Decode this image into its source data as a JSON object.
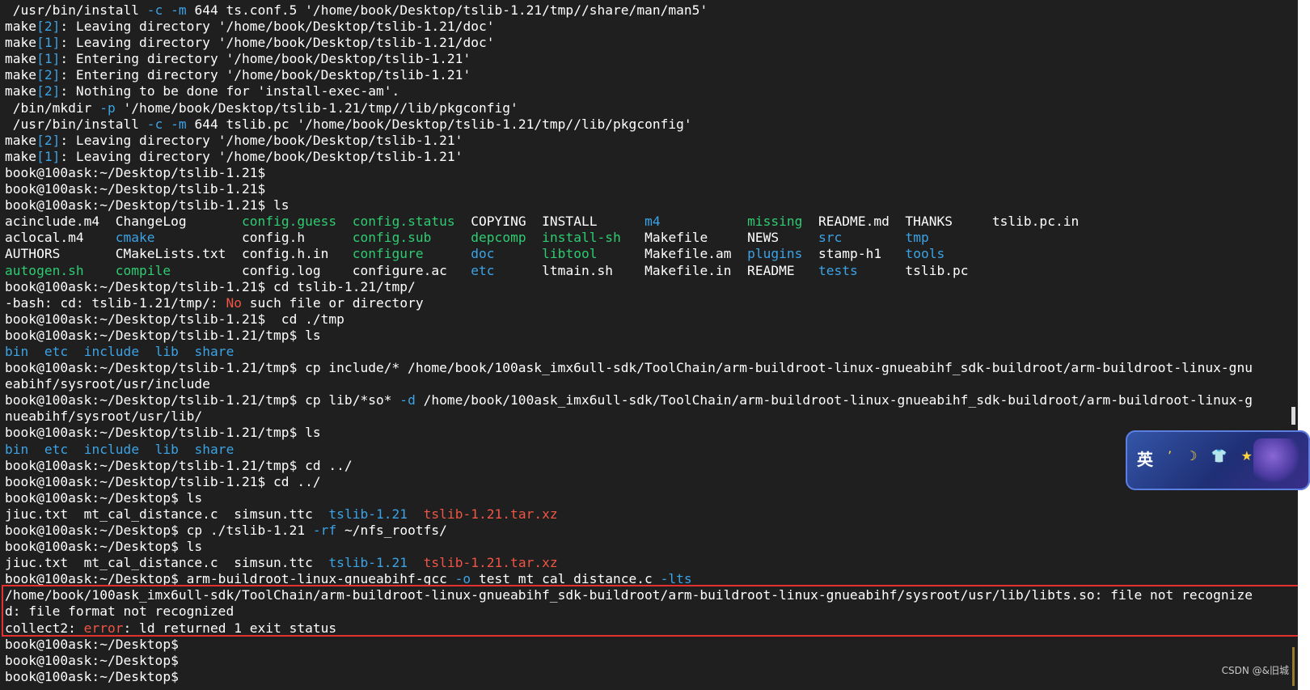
{
  "terminal": {
    "lines": [
      [
        {
          "t": " /usr/bin/install ",
          "c": "w"
        },
        {
          "t": "-c",
          "c": "c"
        },
        {
          "t": " ",
          "c": "w"
        },
        {
          "t": "-m",
          "c": "c"
        },
        {
          "t": " 644 ts.conf.5 '/home/book/Desktop/tslib-1.21/tmp//share/man/man5'",
          "c": "w"
        }
      ],
      [
        {
          "t": "make",
          "c": "w"
        },
        {
          "t": "[2]",
          "c": "c"
        },
        {
          "t": ": Leaving directory '/home/book/Desktop/tslib-1.21/doc'",
          "c": "w"
        }
      ],
      [
        {
          "t": "make",
          "c": "w"
        },
        {
          "t": "[1]",
          "c": "c"
        },
        {
          "t": ": Leaving directory '/home/book/Desktop/tslib-1.21/doc'",
          "c": "w"
        }
      ],
      [
        {
          "t": "make",
          "c": "w"
        },
        {
          "t": "[1]",
          "c": "c"
        },
        {
          "t": ": Entering directory '/home/book/Desktop/tslib-1.21'",
          "c": "w"
        }
      ],
      [
        {
          "t": "make",
          "c": "w"
        },
        {
          "t": "[2]",
          "c": "c"
        },
        {
          "t": ": Entering directory '/home/book/Desktop/tslib-1.21'",
          "c": "w"
        }
      ],
      [
        {
          "t": "make",
          "c": "w"
        },
        {
          "t": "[2]",
          "c": "c"
        },
        {
          "t": ": Nothing to be done for 'install-exec-am'.",
          "c": "w"
        }
      ],
      [
        {
          "t": " /bin/mkdir ",
          "c": "w"
        },
        {
          "t": "-p",
          "c": "c"
        },
        {
          "t": " '/home/book/Desktop/tslib-1.21/tmp//lib/pkgconfig'",
          "c": "w"
        }
      ],
      [
        {
          "t": " /usr/bin/install ",
          "c": "w"
        },
        {
          "t": "-c",
          "c": "c"
        },
        {
          "t": " ",
          "c": "w"
        },
        {
          "t": "-m",
          "c": "c"
        },
        {
          "t": " 644 tslib.pc '/home/book/Desktop/tslib-1.21/tmp//lib/pkgconfig'",
          "c": "w"
        }
      ],
      [
        {
          "t": "make",
          "c": "w"
        },
        {
          "t": "[2]",
          "c": "c"
        },
        {
          "t": ": Leaving directory '/home/book/Desktop/tslib-1.21'",
          "c": "w"
        }
      ],
      [
        {
          "t": "make",
          "c": "w"
        },
        {
          "t": "[1]",
          "c": "c"
        },
        {
          "t": ": Leaving directory '/home/book/Desktop/tslib-1.21'",
          "c": "w"
        }
      ],
      [
        {
          "t": "book@100ask:~/Desktop/tslib-1.21$",
          "c": "w"
        }
      ],
      [
        {
          "t": "book@100ask:~/Desktop/tslib-1.21$",
          "c": "w"
        }
      ],
      [
        {
          "t": "book@100ask:~/Desktop/tslib-1.21$ ls",
          "c": "w"
        }
      ],
      [
        {
          "t": "acinclude.m4  ChangeLog       ",
          "c": "w"
        },
        {
          "t": "config.guess",
          "c": "g"
        },
        {
          "t": "  ",
          "c": "w"
        },
        {
          "t": "config.status",
          "c": "g"
        },
        {
          "t": "  COPYING  INSTALL      ",
          "c": "w"
        },
        {
          "t": "m4",
          "c": "c"
        },
        {
          "t": "           ",
          "c": "w"
        },
        {
          "t": "missing",
          "c": "g"
        },
        {
          "t": "  README.md  THANKS     tslib.pc.in",
          "c": "w"
        }
      ],
      [
        {
          "t": "aclocal.m4    ",
          "c": "w"
        },
        {
          "t": "cmake",
          "c": "c"
        },
        {
          "t": "           config.h      ",
          "c": "w"
        },
        {
          "t": "config.sub",
          "c": "g"
        },
        {
          "t": "     ",
          "c": "w"
        },
        {
          "t": "depcomp",
          "c": "g"
        },
        {
          "t": "  ",
          "c": "w"
        },
        {
          "t": "install-sh",
          "c": "g"
        },
        {
          "t": "   Makefile     NEWS     ",
          "c": "w"
        },
        {
          "t": "src",
          "c": "c"
        },
        {
          "t": "        ",
          "c": "w"
        },
        {
          "t": "tmp",
          "c": "c"
        }
      ],
      [
        {
          "t": "AUTHORS       CMakeLists.txt  config.h.in   ",
          "c": "w"
        },
        {
          "t": "configure",
          "c": "g"
        },
        {
          "t": "      ",
          "c": "w"
        },
        {
          "t": "doc",
          "c": "c"
        },
        {
          "t": "      ",
          "c": "w"
        },
        {
          "t": "libtool",
          "c": "g"
        },
        {
          "t": "      Makefile.am  ",
          "c": "w"
        },
        {
          "t": "plugins",
          "c": "c"
        },
        {
          "t": "  stamp-h1   ",
          "c": "w"
        },
        {
          "t": "tools",
          "c": "c"
        }
      ],
      [
        {
          "t": "autogen.sh",
          "c": "g"
        },
        {
          "t": "    ",
          "c": "w"
        },
        {
          "t": "compile",
          "c": "g"
        },
        {
          "t": "         config.log    configure.ac   ",
          "c": "w"
        },
        {
          "t": "etc",
          "c": "c"
        },
        {
          "t": "      ltmain.sh    Makefile.in  README   ",
          "c": "w"
        },
        {
          "t": "tests",
          "c": "c"
        },
        {
          "t": "      tslib.pc",
          "c": "w"
        }
      ],
      [
        {
          "t": "book@100ask:~/Desktop/tslib-1.21$ cd tslib-1.21/tmp/",
          "c": "w"
        }
      ],
      [
        {
          "t": "-bash: cd: tslib-1.21/tmp/: ",
          "c": "w"
        },
        {
          "t": "No",
          "c": "r"
        },
        {
          "t": " such file or directory",
          "c": "w"
        }
      ],
      [
        {
          "t": "book@100ask:~/Desktop/tslib-1.21$  cd ./tmp",
          "c": "w"
        }
      ],
      [
        {
          "t": "book@100ask:~/Desktop/tslib-1.21/tmp$ ls",
          "c": "w"
        }
      ],
      [
        {
          "t": "bin",
          "c": "c"
        },
        {
          "t": "  ",
          "c": "w"
        },
        {
          "t": "etc",
          "c": "c"
        },
        {
          "t": "  ",
          "c": "w"
        },
        {
          "t": "include",
          "c": "c"
        },
        {
          "t": "  ",
          "c": "w"
        },
        {
          "t": "lib",
          "c": "c"
        },
        {
          "t": "  ",
          "c": "w"
        },
        {
          "t": "share",
          "c": "c"
        }
      ],
      [
        {
          "t": "book@100ask:~/Desktop/tslib-1.21/tmp$ cp include/* /home/book/100ask_imx6ull-sdk/ToolChain/arm-buildroot-linux-gnueabihf_sdk-buildroot/arm-buildroot-linux-gnu",
          "c": "w"
        }
      ],
      [
        {
          "t": "eabihf/sysroot/usr/include",
          "c": "w"
        }
      ],
      [
        {
          "t": "book@100ask:~/Desktop/tslib-1.21/tmp$ cp lib/*so* ",
          "c": "w"
        },
        {
          "t": "-d",
          "c": "c"
        },
        {
          "t": " /home/book/100ask_imx6ull-sdk/ToolChain/arm-buildroot-linux-gnueabihf_sdk-buildroot/arm-buildroot-linux-g",
          "c": "w"
        }
      ],
      [
        {
          "t": "nueabihf/sysroot/usr/lib/",
          "c": "w"
        }
      ],
      [
        {
          "t": "book@100ask:~/Desktop/tslib-1.21/tmp$ ls",
          "c": "w"
        }
      ],
      [
        {
          "t": "bin",
          "c": "c"
        },
        {
          "t": "  ",
          "c": "w"
        },
        {
          "t": "etc",
          "c": "c"
        },
        {
          "t": "  ",
          "c": "w"
        },
        {
          "t": "include",
          "c": "c"
        },
        {
          "t": "  ",
          "c": "w"
        },
        {
          "t": "lib",
          "c": "c"
        },
        {
          "t": "  ",
          "c": "w"
        },
        {
          "t": "share",
          "c": "c"
        }
      ],
      [
        {
          "t": "book@100ask:~/Desktop/tslib-1.21/tmp$ cd ../",
          "c": "w"
        }
      ],
      [
        {
          "t": "book@100ask:~/Desktop/tslib-1.21$ cd ../",
          "c": "w"
        }
      ],
      [
        {
          "t": "book@100ask:~/Desktop$ ls",
          "c": "w"
        }
      ],
      [
        {
          "t": "jiuc.txt  mt_cal_distance.c  simsun.ttc  ",
          "c": "w"
        },
        {
          "t": "tslib-1.21",
          "c": "c"
        },
        {
          "t": "  ",
          "c": "w"
        },
        {
          "t": "tslib-1.21.tar.xz",
          "c": "r"
        }
      ],
      [
        {
          "t": "book@100ask:~/Desktop$ cp ./tslib-1.21 ",
          "c": "w"
        },
        {
          "t": "-rf",
          "c": "c"
        },
        {
          "t": " ~/nfs_rootfs/",
          "c": "w"
        }
      ],
      [
        {
          "t": "book@100ask:~/Desktop$ ls",
          "c": "w"
        }
      ],
      [
        {
          "t": "jiuc.txt  mt_cal_distance.c  simsun.ttc  ",
          "c": "w"
        },
        {
          "t": "tslib-1.21",
          "c": "c"
        },
        {
          "t": "  ",
          "c": "w"
        },
        {
          "t": "tslib-1.21.tar.xz",
          "c": "r"
        }
      ],
      [
        {
          "t": "book@100ask:~/Desktop$ arm-buildroot-linux-gnueabihf-gcc ",
          "c": "w"
        },
        {
          "t": "-o",
          "c": "c"
        },
        {
          "t": " test mt_cal_distance.c ",
          "c": "w"
        },
        {
          "t": "-lts",
          "c": "c"
        }
      ],
      [
        {
          "t": "/home/book/100ask_imx6ull-sdk/ToolChain/arm-buildroot-linux-gnueabihf_sdk-buildroot/arm-buildroot-linux-gnueabihf/sysroot/usr/lib/libts.so: file not recognize",
          "c": "w"
        }
      ],
      [
        {
          "t": "d: file format not recognized",
          "c": "w"
        }
      ],
      [
        {
          "t": "collect2: ",
          "c": "w"
        },
        {
          "t": "error",
          "c": "r"
        },
        {
          "t": ": ld returned 1 exit status",
          "c": "w"
        }
      ],
      [
        {
          "t": "book@100ask:~/Desktop$",
          "c": "w"
        }
      ],
      [
        {
          "t": "book@100ask:~/Desktop$",
          "c": "w"
        }
      ],
      [
        {
          "t": "book@100ask:~/Desktop$",
          "c": "w"
        }
      ]
    ]
  },
  "ime": {
    "language": "英",
    "icons": "’ ☽ 👕 ★"
  },
  "watermark": "CSDN @&旧城"
}
